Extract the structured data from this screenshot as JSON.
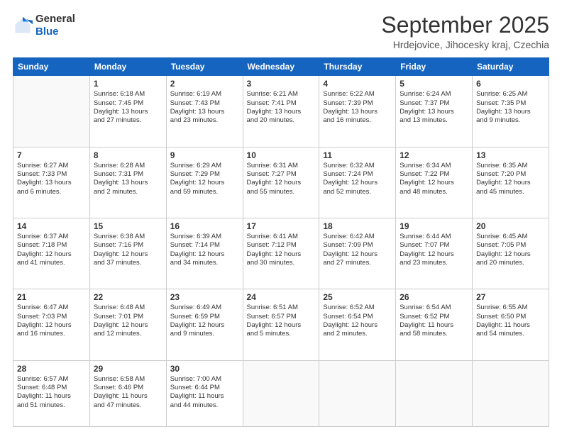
{
  "header": {
    "logo_general": "General",
    "logo_blue": "Blue",
    "title": "September 2025",
    "subtitle": "Hrdejovice, Jihocesky kraj, Czechia"
  },
  "weekdays": [
    "Sunday",
    "Monday",
    "Tuesday",
    "Wednesday",
    "Thursday",
    "Friday",
    "Saturday"
  ],
  "weeks": [
    [
      {
        "day": "",
        "lines": []
      },
      {
        "day": "1",
        "lines": [
          "Sunrise: 6:18 AM",
          "Sunset: 7:45 PM",
          "Daylight: 13 hours",
          "and 27 minutes."
        ]
      },
      {
        "day": "2",
        "lines": [
          "Sunrise: 6:19 AM",
          "Sunset: 7:43 PM",
          "Daylight: 13 hours",
          "and 23 minutes."
        ]
      },
      {
        "day": "3",
        "lines": [
          "Sunrise: 6:21 AM",
          "Sunset: 7:41 PM",
          "Daylight: 13 hours",
          "and 20 minutes."
        ]
      },
      {
        "day": "4",
        "lines": [
          "Sunrise: 6:22 AM",
          "Sunset: 7:39 PM",
          "Daylight: 13 hours",
          "and 16 minutes."
        ]
      },
      {
        "day": "5",
        "lines": [
          "Sunrise: 6:24 AM",
          "Sunset: 7:37 PM",
          "Daylight: 13 hours",
          "and 13 minutes."
        ]
      },
      {
        "day": "6",
        "lines": [
          "Sunrise: 6:25 AM",
          "Sunset: 7:35 PM",
          "Daylight: 13 hours",
          "and 9 minutes."
        ]
      }
    ],
    [
      {
        "day": "7",
        "lines": [
          "Sunrise: 6:27 AM",
          "Sunset: 7:33 PM",
          "Daylight: 13 hours",
          "and 6 minutes."
        ]
      },
      {
        "day": "8",
        "lines": [
          "Sunrise: 6:28 AM",
          "Sunset: 7:31 PM",
          "Daylight: 13 hours",
          "and 2 minutes."
        ]
      },
      {
        "day": "9",
        "lines": [
          "Sunrise: 6:29 AM",
          "Sunset: 7:29 PM",
          "Daylight: 12 hours",
          "and 59 minutes."
        ]
      },
      {
        "day": "10",
        "lines": [
          "Sunrise: 6:31 AM",
          "Sunset: 7:27 PM",
          "Daylight: 12 hours",
          "and 55 minutes."
        ]
      },
      {
        "day": "11",
        "lines": [
          "Sunrise: 6:32 AM",
          "Sunset: 7:24 PM",
          "Daylight: 12 hours",
          "and 52 minutes."
        ]
      },
      {
        "day": "12",
        "lines": [
          "Sunrise: 6:34 AM",
          "Sunset: 7:22 PM",
          "Daylight: 12 hours",
          "and 48 minutes."
        ]
      },
      {
        "day": "13",
        "lines": [
          "Sunrise: 6:35 AM",
          "Sunset: 7:20 PM",
          "Daylight: 12 hours",
          "and 45 minutes."
        ]
      }
    ],
    [
      {
        "day": "14",
        "lines": [
          "Sunrise: 6:37 AM",
          "Sunset: 7:18 PM",
          "Daylight: 12 hours",
          "and 41 minutes."
        ]
      },
      {
        "day": "15",
        "lines": [
          "Sunrise: 6:38 AM",
          "Sunset: 7:16 PM",
          "Daylight: 12 hours",
          "and 37 minutes."
        ]
      },
      {
        "day": "16",
        "lines": [
          "Sunrise: 6:39 AM",
          "Sunset: 7:14 PM",
          "Daylight: 12 hours",
          "and 34 minutes."
        ]
      },
      {
        "day": "17",
        "lines": [
          "Sunrise: 6:41 AM",
          "Sunset: 7:12 PM",
          "Daylight: 12 hours",
          "and 30 minutes."
        ]
      },
      {
        "day": "18",
        "lines": [
          "Sunrise: 6:42 AM",
          "Sunset: 7:09 PM",
          "Daylight: 12 hours",
          "and 27 minutes."
        ]
      },
      {
        "day": "19",
        "lines": [
          "Sunrise: 6:44 AM",
          "Sunset: 7:07 PM",
          "Daylight: 12 hours",
          "and 23 minutes."
        ]
      },
      {
        "day": "20",
        "lines": [
          "Sunrise: 6:45 AM",
          "Sunset: 7:05 PM",
          "Daylight: 12 hours",
          "and 20 minutes."
        ]
      }
    ],
    [
      {
        "day": "21",
        "lines": [
          "Sunrise: 6:47 AM",
          "Sunset: 7:03 PM",
          "Daylight: 12 hours",
          "and 16 minutes."
        ]
      },
      {
        "day": "22",
        "lines": [
          "Sunrise: 6:48 AM",
          "Sunset: 7:01 PM",
          "Daylight: 12 hours",
          "and 12 minutes."
        ]
      },
      {
        "day": "23",
        "lines": [
          "Sunrise: 6:49 AM",
          "Sunset: 6:59 PM",
          "Daylight: 12 hours",
          "and 9 minutes."
        ]
      },
      {
        "day": "24",
        "lines": [
          "Sunrise: 6:51 AM",
          "Sunset: 6:57 PM",
          "Daylight: 12 hours",
          "and 5 minutes."
        ]
      },
      {
        "day": "25",
        "lines": [
          "Sunrise: 6:52 AM",
          "Sunset: 6:54 PM",
          "Daylight: 12 hours",
          "and 2 minutes."
        ]
      },
      {
        "day": "26",
        "lines": [
          "Sunrise: 6:54 AM",
          "Sunset: 6:52 PM",
          "Daylight: 11 hours",
          "and 58 minutes."
        ]
      },
      {
        "day": "27",
        "lines": [
          "Sunrise: 6:55 AM",
          "Sunset: 6:50 PM",
          "Daylight: 11 hours",
          "and 54 minutes."
        ]
      }
    ],
    [
      {
        "day": "28",
        "lines": [
          "Sunrise: 6:57 AM",
          "Sunset: 6:48 PM",
          "Daylight: 11 hours",
          "and 51 minutes."
        ]
      },
      {
        "day": "29",
        "lines": [
          "Sunrise: 6:58 AM",
          "Sunset: 6:46 PM",
          "Daylight: 11 hours",
          "and 47 minutes."
        ]
      },
      {
        "day": "30",
        "lines": [
          "Sunrise: 7:00 AM",
          "Sunset: 6:44 PM",
          "Daylight: 11 hours",
          "and 44 minutes."
        ]
      },
      {
        "day": "",
        "lines": []
      },
      {
        "day": "",
        "lines": []
      },
      {
        "day": "",
        "lines": []
      },
      {
        "day": "",
        "lines": []
      }
    ]
  ]
}
